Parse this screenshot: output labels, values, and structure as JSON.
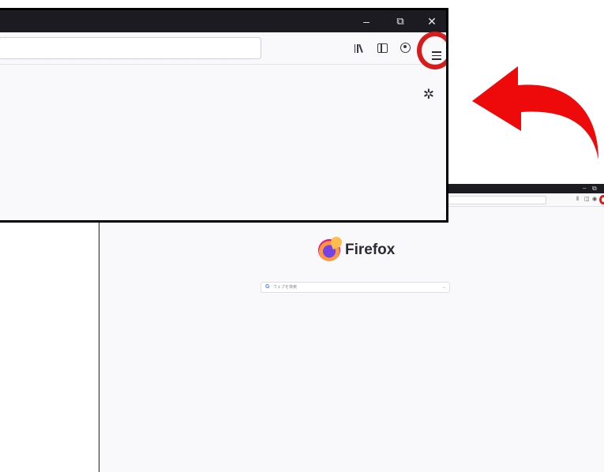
{
  "colors": {
    "titlebar": "#1c1b22",
    "page_background": "#f9f9fb",
    "highlight_ring": "#d61c1c",
    "arrow": "#ee0a0a"
  },
  "zoomed_window": {
    "window_controls": {
      "minimize_glyph": "–",
      "restore_glyph": "⧉",
      "close_glyph": "✕"
    },
    "toolbar": {
      "library_icon": "library-icon",
      "sidebar_icon": "sidebar-icon",
      "account_icon": "account-icon",
      "menu_icon": "hamburger-menu-icon"
    },
    "settings_icon_glyph": "✲"
  },
  "background_window": {
    "brand_name": "Firefox",
    "search": {
      "engine_glyph": "G",
      "placeholder": "ウェブを検索",
      "go_glyph": "→"
    }
  }
}
